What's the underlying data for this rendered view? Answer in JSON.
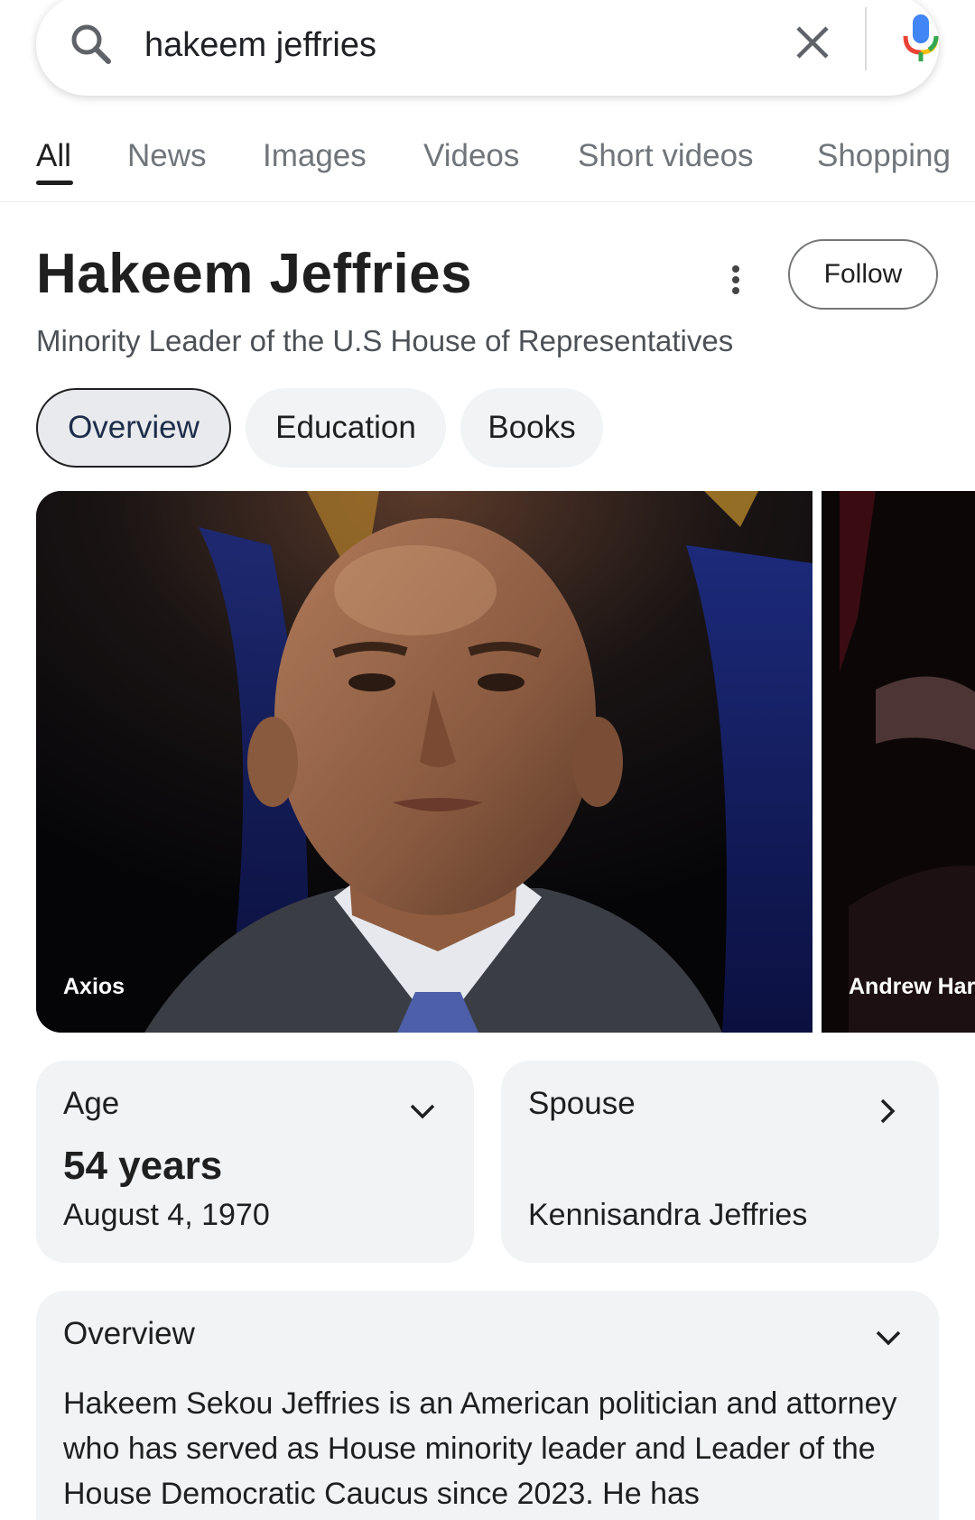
{
  "search": {
    "query": "hakeem jeffries",
    "icons": [
      "search-icon",
      "close-icon",
      "mic-icon"
    ]
  },
  "tabs": [
    {
      "label": "All",
      "active": true
    },
    {
      "label": "News"
    },
    {
      "label": "Images"
    },
    {
      "label": "Videos"
    },
    {
      "label": "Short videos"
    },
    {
      "label": "Shopping"
    }
  ],
  "entity": {
    "title": "Hakeem Jeffries",
    "subtitle": "Minority Leader of the U.S House of Representatives",
    "follow_label": "Follow"
  },
  "chips": [
    {
      "label": "Overview",
      "selected": true
    },
    {
      "label": "Education"
    },
    {
      "label": "Books"
    }
  ],
  "images": [
    {
      "source": "Axios"
    },
    {
      "source": "Andrew Harr"
    }
  ],
  "age_card": {
    "label": "Age",
    "value": "54 years",
    "date": "August 4, 1970"
  },
  "spouse_card": {
    "label": "Spouse",
    "value": "Kennisandra Jeffries"
  },
  "overview_card": {
    "label": "Overview",
    "text": "Hakeem Sekou Jeffries is an American politician and attorney who has served as House minority leader and Leader of the House Democratic Caucus since 2023. He has"
  },
  "colors": {
    "mic_blue": "#4285f4",
    "mic_red": "#ea4335",
    "mic_yellow": "#fbbc05",
    "mic_green": "#34a853",
    "card_bg": "#f1f3f4"
  }
}
